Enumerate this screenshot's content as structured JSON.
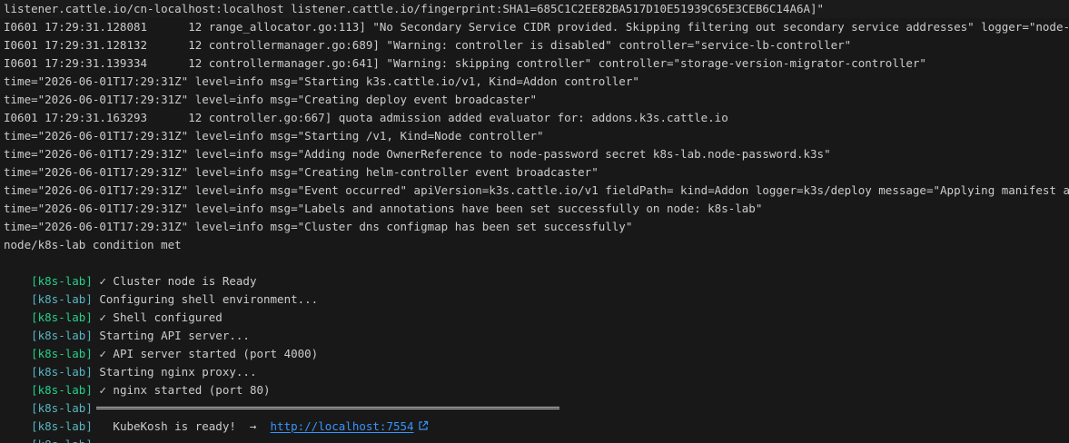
{
  "terminal": {
    "lines": [
      "listener.cattle.io/cn-localhost:localhost listener.cattle.io/fingerprint:SHA1=685C1C2EE82BA517D10E51939C65E3CEB6C14A6A]\"",
      "I0601 17:29:31.128081      12 range_allocator.go:113] \"No Secondary Service CIDR provided. Skipping filtering out secondary service addresses\" logger=\"node-ipam-c",
      "I0601 17:29:31.128132      12 controllermanager.go:689] \"Warning: controller is disabled\" controller=\"service-lb-controller\"",
      "I0601 17:29:31.139334      12 controllermanager.go:641] \"Warning: skipping controller\" controller=\"storage-version-migrator-controller\"",
      "time=\"2026-06-01T17:29:31Z\" level=info msg=\"Starting k3s.cattle.io/v1, Kind=Addon controller\"",
      "time=\"2026-06-01T17:29:31Z\" level=info msg=\"Creating deploy event broadcaster\"",
      "I0601 17:29:31.163293      12 controller.go:667] quota admission added evaluator for: addons.k3s.cattle.io",
      "time=\"2026-06-01T17:29:31Z\" level=info msg=\"Starting /v1, Kind=Node controller\"",
      "time=\"2026-06-01T17:29:31Z\" level=info msg=\"Adding node OwnerReference to node-password secret k8s-lab.node-password.k3s\"",
      "time=\"2026-06-01T17:29:31Z\" level=info msg=\"Creating helm-controller event broadcaster\"",
      "time=\"2026-06-01T17:29:31Z\" level=info msg=\"Event occurred\" apiVersion=k3s.cattle.io/v1 fieldPath= kind=Addon logger=k3s/deploy message=\"Applying manifest at \\\"/",
      "time=\"2026-06-01T17:29:31Z\" level=info msg=\"Labels and annotations have been set successfully on node: k8s-lab\"",
      "time=\"2026-06-01T17:29:31Z\" level=info msg=\"Cluster dns configmap has been set successfully\"",
      "node/k8s-lab condition met"
    ],
    "prefix": "[k8s-lab]",
    "status_lines": [
      "✓ Cluster node is Ready",
      "Configuring shell environment...",
      "✓ Shell configured",
      "Starting API server...",
      "✓ API server started (port 4000)",
      "Starting nginx proxy...",
      "✓ nginx started (port 80)"
    ],
    "ready_text": "   KubeKosh is ready!  →  ",
    "ready_link": "http://localhost:7554",
    "colors": {
      "background": "#181818",
      "foreground": "#cccccc",
      "prefix_cyan": "#56b6c2",
      "prefix_green": "#23d18b",
      "link": "#3794ff"
    }
  }
}
